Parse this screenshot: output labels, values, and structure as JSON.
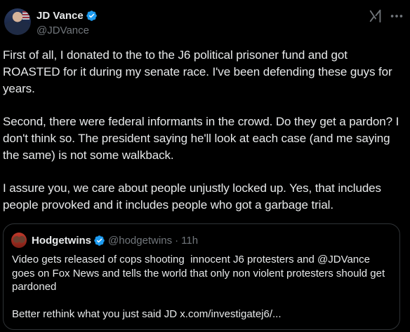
{
  "tweet": {
    "author": {
      "display_name": "JD Vance",
      "handle": "@JDVance",
      "verified": true,
      "avatar_icon": "profile-photo"
    },
    "actions": {
      "grok_icon": "grok-icon",
      "more_icon": "more-options-icon"
    },
    "paragraphs": [
      "First of all, I donated to the to the J6 political prisoner fund and got ROASTED for it during my senate race. I've been defending these guys for years.",
      "Second, there were federal informants in the crowd. Do they get a pardon? I don't think so. The president saying he'll look at each case (and me saying the same) is not some walkback.",
      "I assure you, we care about people unjustly locked up. Yes, that includes people provoked and it includes people who got a garbage trial."
    ],
    "quote": {
      "display_name": "Hodgetwins",
      "handle": "@hodgetwins",
      "separator": "·",
      "time": "11h",
      "verified": true,
      "text_main": "Video gets released of cops shooting  innocent J6 protesters and @JDVance goes on Fox News and tells the world that only non violent protesters should get pardoned",
      "text_tail_prefix": "Better rethink what you just said JD ",
      "text_link": "x.com/investigatej6/..."
    }
  },
  "colors": {
    "background": "#000000",
    "text": "#e7e9ea",
    "muted": "#71767b",
    "border": "#2f3336",
    "verified_blue": "#1d9bf0"
  }
}
